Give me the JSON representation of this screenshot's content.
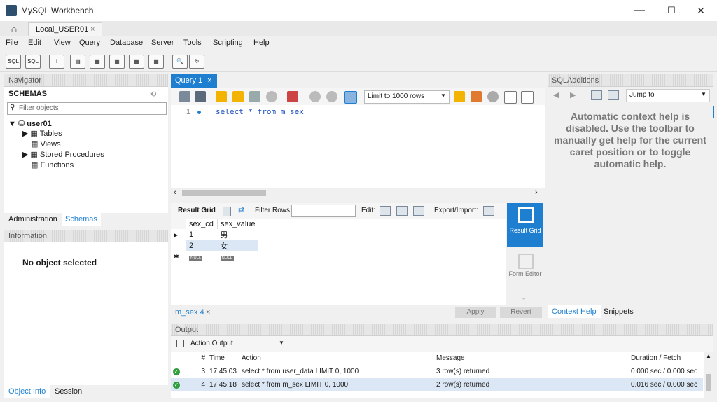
{
  "window": {
    "title": "MySQL Workbench",
    "minimize": "—",
    "maximize": "☐",
    "close": "✕"
  },
  "connection_tab": {
    "label": "Local_USER01",
    "close": "×"
  },
  "menu": [
    "File",
    "Edit",
    "View",
    "Query",
    "Database",
    "Server",
    "Tools",
    "Scripting",
    "Help"
  ],
  "navigator": {
    "header": "Navigator",
    "schemas_label": "SCHEMAS",
    "filter_placeholder": "Filter objects",
    "schema": "user01",
    "children": [
      "Tables",
      "Views",
      "Stored Procedures",
      "Functions"
    ],
    "tabs": [
      "Administration",
      "Schemas"
    ]
  },
  "information": {
    "header": "Information",
    "message": "No object selected",
    "tabs": [
      "Object Info",
      "Session"
    ]
  },
  "query": {
    "tab_label": "Query 1",
    "tab_close": "×",
    "limit_label": "Limit to 1000 rows",
    "line_number": "1",
    "sql": "select * from m_sex"
  },
  "results": {
    "tab_label": "Result Grid",
    "filter_label": "Filter Rows:",
    "edit_label": "Edit:",
    "export_label": "Export/Import:",
    "columns": [
      "sex_cd",
      "sex_value"
    ],
    "rows": [
      [
        "1",
        "男"
      ],
      [
        "2",
        "女"
      ]
    ],
    "null_label": "NULL",
    "side": {
      "result_grid": "Result Grid",
      "form_editor": "Form Editor"
    },
    "bottom_tab": "m_sex 4",
    "bottom_close": "×",
    "apply": "Apply",
    "revert": "Revert"
  },
  "sql_additions": {
    "header": "SQLAdditions",
    "jump_to": "Jump to",
    "help_text": "Automatic context help is disabled. Use the toolbar to manually get help for the current caret position or to toggle automatic help.",
    "tabs": [
      "Context Help",
      "Snippets"
    ]
  },
  "output": {
    "header": "Output",
    "dropdown": "Action Output",
    "columns": [
      "#",
      "Time",
      "Action",
      "Message",
      "Duration / Fetch"
    ],
    "rows": [
      {
        "num": "3",
        "time": "17:45:03",
        "action": "select * from user_data LIMIT 0, 1000",
        "message": "3 row(s) returned",
        "duration": "0.000 sec / 0.000 sec"
      },
      {
        "num": "4",
        "time": "17:45:18",
        "action": "select * from m_sex LIMIT 0, 1000",
        "message": "2 row(s) returned",
        "duration": "0.016 sec / 0.000 sec"
      }
    ]
  },
  "colors": {
    "accent": "#1e7fd0",
    "ok": "#2e9d3a",
    "keyword": "#1f4fbf"
  }
}
